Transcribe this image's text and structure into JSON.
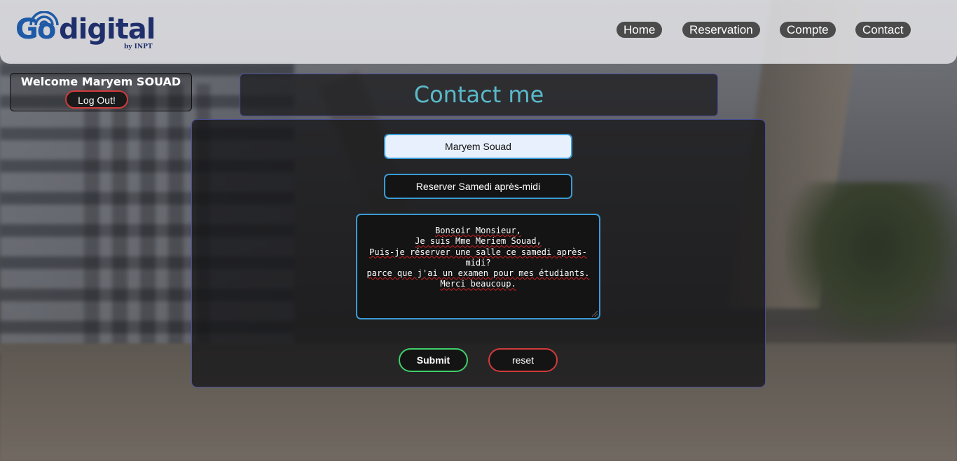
{
  "header": {
    "logo": {
      "go": "Go",
      "digital": "digital",
      "by": "by INPT"
    },
    "nav": [
      {
        "label": "Home"
      },
      {
        "label": "Reservation"
      },
      {
        "label": "Compte"
      },
      {
        "label": "Contact"
      }
    ]
  },
  "welcome": {
    "text": "Welcome Maryem SOUAD",
    "logout_label": "Log Out!"
  },
  "page": {
    "title": "Contact me"
  },
  "form": {
    "name_value": "Maryem Souad",
    "subject_value": "Reserver Samedi après-midi",
    "message_lines": [
      "Bonsoir Monsieur,",
      "Je suis Mme Meriem Souad,",
      "Puis-je réserver une salle ce samedi après-",
      "midi?",
      "parce que j'ai un examen pour mes étudiants.",
      "Merci beaucoup."
    ],
    "submit_label": "Submit",
    "reset_label": "reset"
  },
  "colors": {
    "title": "#5ab9c9",
    "input_border": "#3a9bd4",
    "submit_border": "#3fcf6a",
    "reset_border": "#d13b3b",
    "logo_blue": "#1f5aa6",
    "logo_navy": "#1e2f6b"
  },
  "icons": {
    "logo_wifi": "wifi-icon",
    "textarea_resize": "resize-handle-icon"
  }
}
